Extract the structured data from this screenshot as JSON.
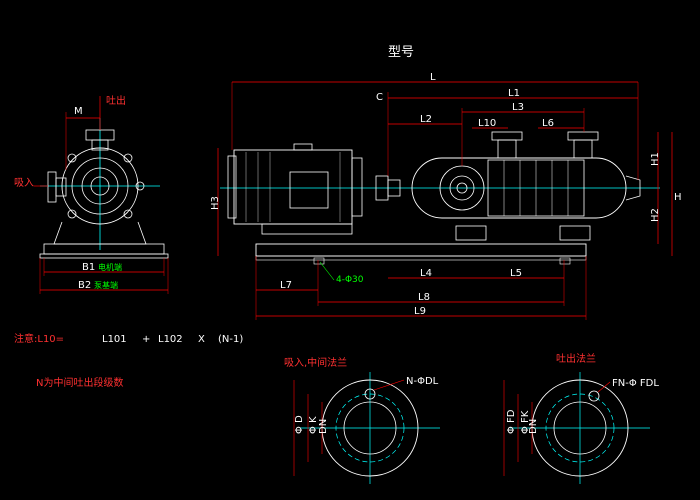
{
  "title": "型号",
  "colors": {
    "background": "#000000",
    "outline": "#ffffff",
    "centerline": "#00ffff",
    "dimension": "#ff0000",
    "label": "#ffff00",
    "accent": "#00ff00"
  },
  "side_view": {
    "dim_M": "M",
    "outlet": "吐出",
    "inlet": "吸入",
    "dim_B1": "B1",
    "dim_B1_note": "电机端",
    "dim_B2": "B2",
    "dim_B2_note": "泵基端"
  },
  "front_view": {
    "dims": {
      "L": "L",
      "L1": "L1",
      "L2": "L2",
      "L3": "L3",
      "L10": "L10",
      "L6": "L6",
      "C": "C",
      "H1": "H1",
      "H2": "H2",
      "H": "H",
      "H3": "H3",
      "L4": "L4",
      "L5": "L5",
      "L7": "L7",
      "L8": "L8",
      "L9": "L9"
    },
    "holes": "4-Φ30"
  },
  "formula": {
    "prefix": "注意:L10=",
    "t1": "L101",
    "plus": "+",
    "t2": "L102",
    "times": "X",
    "t3": "(N-1)"
  },
  "note": "N为中间吐出段级数",
  "inlet_flange": {
    "title": "吸入,中间法兰",
    "holes": "N-ΦDL",
    "d": "Φ D",
    "k": "Φ K",
    "dn": "DN"
  },
  "outlet_flange": {
    "title": "吐出法兰",
    "holes": "FN-Φ FDL",
    "d": "Φ FD",
    "k": "Φ FK",
    "dn": "DN"
  }
}
